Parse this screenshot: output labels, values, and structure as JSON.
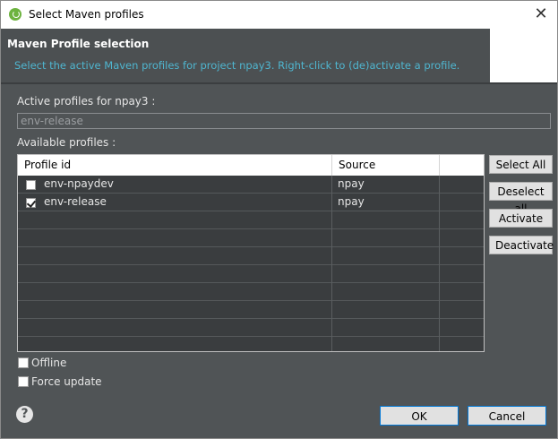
{
  "window": {
    "title": "Select Maven profiles",
    "close_glyph": "✕"
  },
  "header": {
    "title": "Maven Profile selection",
    "description": "Select the active Maven profiles for project npay3. Right-click to (de)activate a profile."
  },
  "active_profiles": {
    "label": "Active profiles for npay3 :",
    "value": "env-release"
  },
  "available_profiles": {
    "label": "Available profiles :",
    "columns": [
      "Profile id",
      "Source"
    ],
    "rows": [
      {
        "checked": false,
        "profile_id": "env-npaydev",
        "source": "npay"
      },
      {
        "checked": true,
        "profile_id": "env-release",
        "source": "npay"
      }
    ]
  },
  "side_buttons": {
    "select_all": "Select All",
    "deselect_all": "Deselect all",
    "activate": "Activate",
    "deactivate": "Deactivate"
  },
  "options": {
    "offline": "Offline",
    "force_update": "Force update"
  },
  "footer": {
    "help_glyph": "?",
    "ok": "OK",
    "cancel": "Cancel"
  },
  "colors": {
    "accent": "#0078d7",
    "header_bg": "#4c5052",
    "desc_text": "#4fb6d0",
    "spring_green": "#6db33f"
  }
}
